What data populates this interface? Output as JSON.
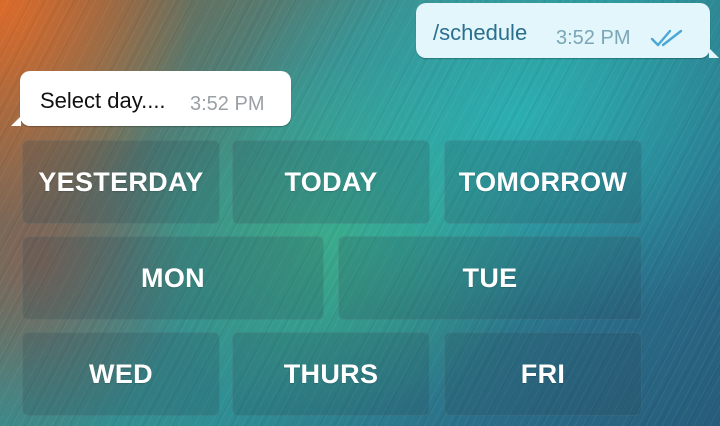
{
  "chat": {
    "outgoing": {
      "text": "/schedule",
      "time": "3:52 PM",
      "status_icon": "double-check-icon"
    },
    "incoming": {
      "text": "Select day....",
      "time": "3:52 PM"
    }
  },
  "keyboard": {
    "row1": [
      "YESTERDAY",
      "TODAY",
      "TOMORROW"
    ],
    "row2": [
      "MON",
      "TUE"
    ],
    "row3": [
      "WED",
      "THURS",
      "FRI"
    ]
  },
  "colors": {
    "outgoing_bubble": "#e2f6fb",
    "incoming_bubble": "#ffffff",
    "outgoing_text": "#2b6f8e",
    "check_color": "#4aa7d6"
  }
}
